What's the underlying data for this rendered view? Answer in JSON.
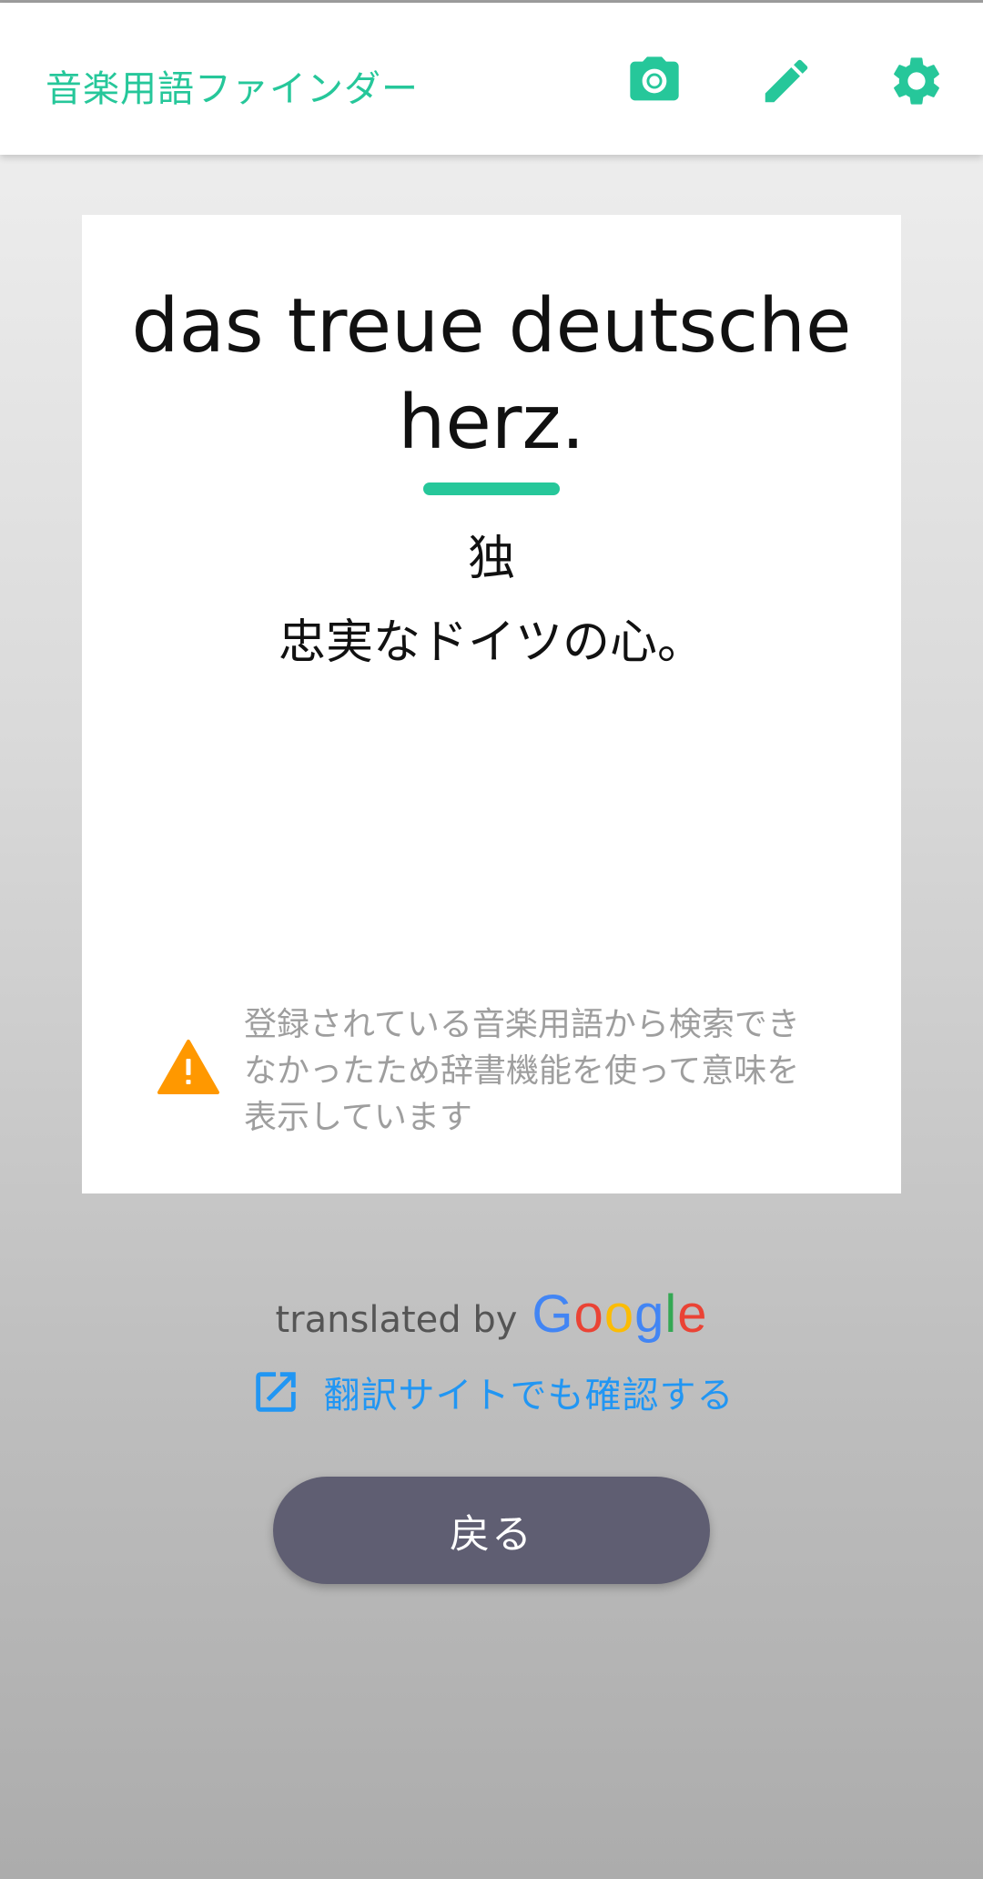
{
  "app": {
    "title": "音楽用語ファインダー",
    "accent_color": "#26c79a"
  },
  "toolbar": {
    "icons": [
      "camera-icon",
      "pencil-icon",
      "gear-icon"
    ]
  },
  "result": {
    "term": "das treue deutsche herz.",
    "meaning": "独\n忠実なドイツの心。",
    "notice_icon": "warning-icon",
    "notice": "登録されている音楽用語から検索できなかったため辞書機能を使って意味を表示しています"
  },
  "attribution": {
    "label": "translated by",
    "brand": "Google"
  },
  "link": {
    "icon": "open-in-new-icon",
    "label": "翻訳サイトでも確認する",
    "color": "#2196f3"
  },
  "back_button": {
    "label": "戻る",
    "color": "#5f5e72"
  }
}
